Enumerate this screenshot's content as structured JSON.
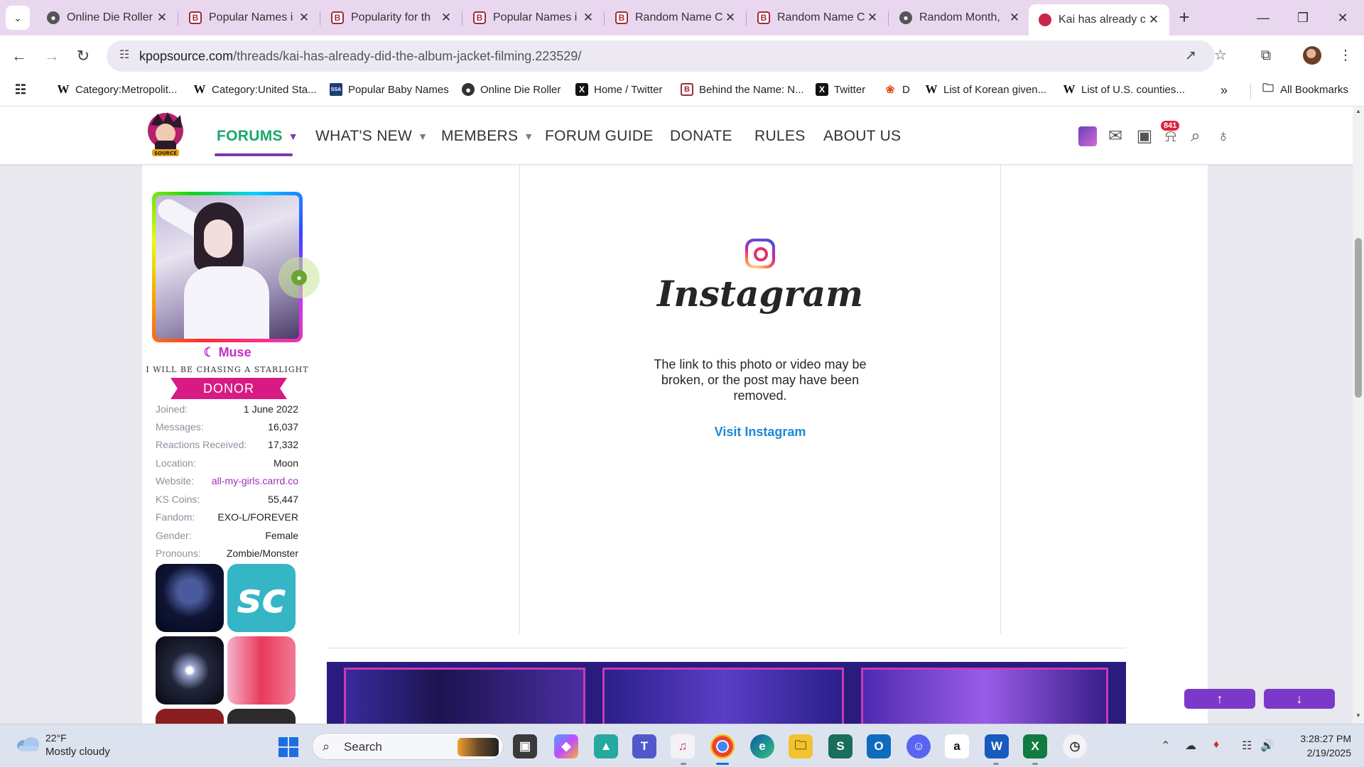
{
  "browser": {
    "tabs": [
      {
        "title": "Online Die Roller",
        "favicon": "globe-icon"
      },
      {
        "title": "Popular Names i",
        "favicon": "behind-the-name-icon"
      },
      {
        "title": "Popularity for th",
        "favicon": "behind-the-name-icon"
      },
      {
        "title": "Popular Names i",
        "favicon": "behind-the-name-icon"
      },
      {
        "title": "Random Name C",
        "favicon": "behind-the-name-icon"
      },
      {
        "title": "Random Name C",
        "favicon": "behind-the-name-icon"
      },
      {
        "title": "Random Month,",
        "favicon": "globe-icon"
      },
      {
        "title": "Kai has already c",
        "favicon": "kpopsource-icon",
        "active": true
      }
    ],
    "url_host": "kpopsource.com",
    "url_path": "/threads/kai-has-already-did-the-album-jacket-filming.223529/",
    "bookmarks": [
      {
        "label": "Category:Metropolit...",
        "icon": "wikipedia-icon"
      },
      {
        "label": "Category:United Sta...",
        "icon": "wikipedia-icon"
      },
      {
        "label": "Popular Baby Names",
        "icon": "ssa-icon"
      },
      {
        "label": "Online Die Roller",
        "icon": "globe-icon"
      },
      {
        "label": "Home / Twitter",
        "icon": "x-icon"
      },
      {
        "label": "Behind the Name: N...",
        "icon": "behind-the-name-icon"
      },
      {
        "label": "Twitter",
        "icon": "x-icon"
      },
      {
        "label": "D",
        "icon": "pinwheel-icon"
      },
      {
        "label": "List of Korean given...",
        "icon": "wikipedia-icon"
      },
      {
        "label": "List of U.S. counties...",
        "icon": "wikipedia-icon"
      }
    ],
    "all_bookmarks": "All Bookmarks"
  },
  "site": {
    "nav": [
      {
        "label": "FORUMS",
        "active": true,
        "dropdown": true
      },
      {
        "label": "WHAT'S NEW",
        "dropdown": true
      },
      {
        "label": "MEMBERS",
        "dropdown": true
      },
      {
        "label": "FORUM GUIDE"
      },
      {
        "label": "DONATE"
      },
      {
        "label": "RULES"
      },
      {
        "label": "ABOUT US"
      }
    ],
    "alert_count": "841"
  },
  "user": {
    "role": "Muse",
    "tagline": "I WILL BE CHASING A STARLIGHT",
    "banner": "DONOR",
    "stats": [
      {
        "key": "Joined:",
        "value": "1 June 2022"
      },
      {
        "key": "Messages:",
        "value": "16,037"
      },
      {
        "key": "Reactions Received:",
        "value": "17,332"
      },
      {
        "key": "Location:",
        "value": "Moon"
      },
      {
        "key": "Website:",
        "value": "all-my-girls.carrd.co",
        "link": true
      },
      {
        "key": "KS Coins:",
        "value": "55,447"
      },
      {
        "key": "Fandom:",
        "value": "EXO-L/FOREVER"
      },
      {
        "key": "Gender:",
        "value": "Female"
      },
      {
        "key": "Pronouns:",
        "value": "Zombie/Monster"
      }
    ]
  },
  "embed": {
    "brand": "Instagram",
    "message": "The link to this photo or video may be broken, or the post may have been removed.",
    "link": "Visit Instagram"
  },
  "taskbar": {
    "temperature": "22°F",
    "weather": "Mostly cloudy",
    "search_label": "Search",
    "time": "3:28:27 PM",
    "date": "2/19/2025"
  },
  "colors": {
    "tabstrip": "#e9d7f0",
    "forums_active": "#1aa86b",
    "accent_purple": "#7c39a8",
    "donor": "#d81b84",
    "instagram_link": "#1b89d8"
  }
}
